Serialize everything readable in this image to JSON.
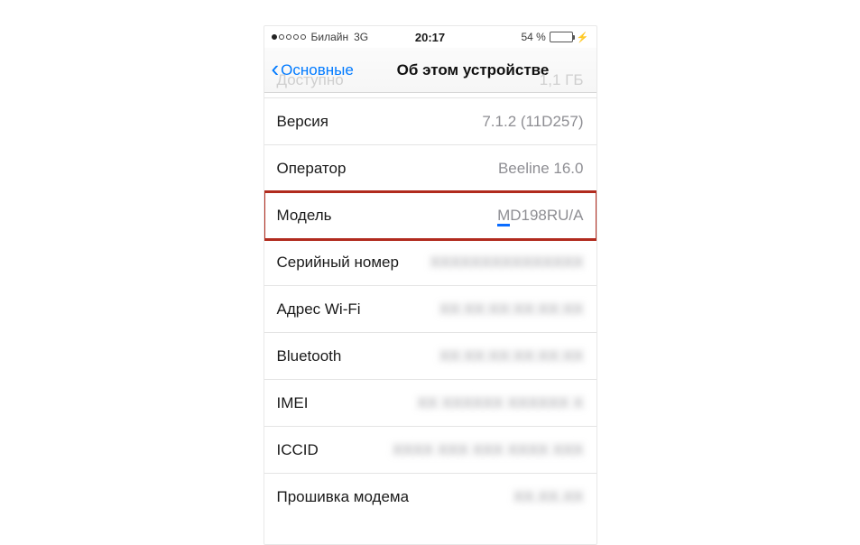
{
  "statusbar": {
    "carrier": "Билайн",
    "network": "3G",
    "time": "20:17",
    "battery_percent": "54 %"
  },
  "nav": {
    "back_label": "Основные",
    "title": "Об этом устройстве"
  },
  "ghost": {
    "label": "Доступно",
    "value": "1,1 ГБ"
  },
  "rows": {
    "version": {
      "label": "Версия",
      "value": "7.1.2 (11D257)"
    },
    "carrier": {
      "label": "Оператор",
      "value": "Beeline 16.0"
    },
    "model": {
      "label": "Модель",
      "value_prefix": "M",
      "value_rest": "D198RU/A"
    },
    "serial": {
      "label": "Серийный номер",
      "value": "XXXXXXXXXXXXXXX"
    },
    "wifi": {
      "label": "Адрес Wi-Fi",
      "value": "XX:XX:XX:XX:XX:XX"
    },
    "bluetooth": {
      "label": "Bluetooth",
      "value": "XX:XX:XX:XX:XX:XX"
    },
    "imei": {
      "label": "IMEI",
      "value": "XX XXXXXX XXXXXX X"
    },
    "iccid": {
      "label": "ICCID",
      "value": "XXXX XXX XXX XXXX XXX"
    },
    "modem": {
      "label": "Прошивка модема",
      "value": "XX.XX.XX"
    }
  }
}
